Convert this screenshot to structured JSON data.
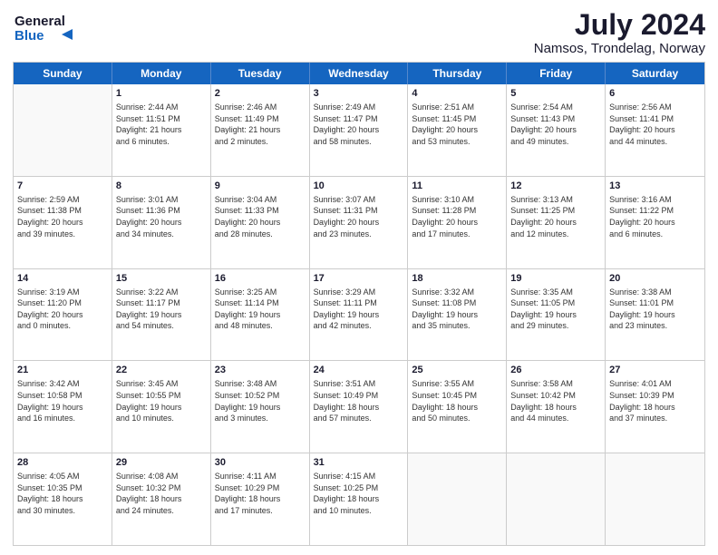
{
  "header": {
    "logo_line1": "General",
    "logo_line2": "Blue",
    "main_title": "July 2024",
    "subtitle": "Namsos, Trondelag, Norway"
  },
  "calendar": {
    "days_of_week": [
      "Sunday",
      "Monday",
      "Tuesday",
      "Wednesday",
      "Thursday",
      "Friday",
      "Saturday"
    ],
    "rows": [
      [
        {
          "day": "",
          "text": ""
        },
        {
          "day": "1",
          "text": "Sunrise: 2:44 AM\nSunset: 11:51 PM\nDaylight: 21 hours\nand 6 minutes."
        },
        {
          "day": "2",
          "text": "Sunrise: 2:46 AM\nSunset: 11:49 PM\nDaylight: 21 hours\nand 2 minutes."
        },
        {
          "day": "3",
          "text": "Sunrise: 2:49 AM\nSunset: 11:47 PM\nDaylight: 20 hours\nand 58 minutes."
        },
        {
          "day": "4",
          "text": "Sunrise: 2:51 AM\nSunset: 11:45 PM\nDaylight: 20 hours\nand 53 minutes."
        },
        {
          "day": "5",
          "text": "Sunrise: 2:54 AM\nSunset: 11:43 PM\nDaylight: 20 hours\nand 49 minutes."
        },
        {
          "day": "6",
          "text": "Sunrise: 2:56 AM\nSunset: 11:41 PM\nDaylight: 20 hours\nand 44 minutes."
        }
      ],
      [
        {
          "day": "7",
          "text": "Sunrise: 2:59 AM\nSunset: 11:38 PM\nDaylight: 20 hours\nand 39 minutes."
        },
        {
          "day": "8",
          "text": "Sunrise: 3:01 AM\nSunset: 11:36 PM\nDaylight: 20 hours\nand 34 minutes."
        },
        {
          "day": "9",
          "text": "Sunrise: 3:04 AM\nSunset: 11:33 PM\nDaylight: 20 hours\nand 28 minutes."
        },
        {
          "day": "10",
          "text": "Sunrise: 3:07 AM\nSunset: 11:31 PM\nDaylight: 20 hours\nand 23 minutes."
        },
        {
          "day": "11",
          "text": "Sunrise: 3:10 AM\nSunset: 11:28 PM\nDaylight: 20 hours\nand 17 minutes."
        },
        {
          "day": "12",
          "text": "Sunrise: 3:13 AM\nSunset: 11:25 PM\nDaylight: 20 hours\nand 12 minutes."
        },
        {
          "day": "13",
          "text": "Sunrise: 3:16 AM\nSunset: 11:22 PM\nDaylight: 20 hours\nand 6 minutes."
        }
      ],
      [
        {
          "day": "14",
          "text": "Sunrise: 3:19 AM\nSunset: 11:20 PM\nDaylight: 20 hours\nand 0 minutes."
        },
        {
          "day": "15",
          "text": "Sunrise: 3:22 AM\nSunset: 11:17 PM\nDaylight: 19 hours\nand 54 minutes."
        },
        {
          "day": "16",
          "text": "Sunrise: 3:25 AM\nSunset: 11:14 PM\nDaylight: 19 hours\nand 48 minutes."
        },
        {
          "day": "17",
          "text": "Sunrise: 3:29 AM\nSunset: 11:11 PM\nDaylight: 19 hours\nand 42 minutes."
        },
        {
          "day": "18",
          "text": "Sunrise: 3:32 AM\nSunset: 11:08 PM\nDaylight: 19 hours\nand 35 minutes."
        },
        {
          "day": "19",
          "text": "Sunrise: 3:35 AM\nSunset: 11:05 PM\nDaylight: 19 hours\nand 29 minutes."
        },
        {
          "day": "20",
          "text": "Sunrise: 3:38 AM\nSunset: 11:01 PM\nDaylight: 19 hours\nand 23 minutes."
        }
      ],
      [
        {
          "day": "21",
          "text": "Sunrise: 3:42 AM\nSunset: 10:58 PM\nDaylight: 19 hours\nand 16 minutes."
        },
        {
          "day": "22",
          "text": "Sunrise: 3:45 AM\nSunset: 10:55 PM\nDaylight: 19 hours\nand 10 minutes."
        },
        {
          "day": "23",
          "text": "Sunrise: 3:48 AM\nSunset: 10:52 PM\nDaylight: 19 hours\nand 3 minutes."
        },
        {
          "day": "24",
          "text": "Sunrise: 3:51 AM\nSunset: 10:49 PM\nDaylight: 18 hours\nand 57 minutes."
        },
        {
          "day": "25",
          "text": "Sunrise: 3:55 AM\nSunset: 10:45 PM\nDaylight: 18 hours\nand 50 minutes."
        },
        {
          "day": "26",
          "text": "Sunrise: 3:58 AM\nSunset: 10:42 PM\nDaylight: 18 hours\nand 44 minutes."
        },
        {
          "day": "27",
          "text": "Sunrise: 4:01 AM\nSunset: 10:39 PM\nDaylight: 18 hours\nand 37 minutes."
        }
      ],
      [
        {
          "day": "28",
          "text": "Sunrise: 4:05 AM\nSunset: 10:35 PM\nDaylight: 18 hours\nand 30 minutes."
        },
        {
          "day": "29",
          "text": "Sunrise: 4:08 AM\nSunset: 10:32 PM\nDaylight: 18 hours\nand 24 minutes."
        },
        {
          "day": "30",
          "text": "Sunrise: 4:11 AM\nSunset: 10:29 PM\nDaylight: 18 hours\nand 17 minutes."
        },
        {
          "day": "31",
          "text": "Sunrise: 4:15 AM\nSunset: 10:25 PM\nDaylight: 18 hours\nand 10 minutes."
        },
        {
          "day": "",
          "text": ""
        },
        {
          "day": "",
          "text": ""
        },
        {
          "day": "",
          "text": ""
        }
      ]
    ]
  }
}
